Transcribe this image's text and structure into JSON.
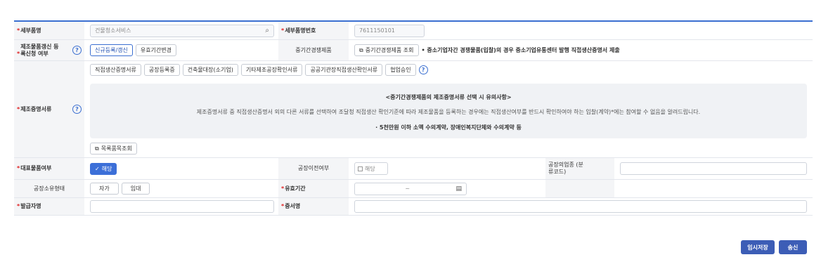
{
  "sub_item": {
    "label": "세부품명",
    "value": "건물청소서비스",
    "code_label": "세부품명번호",
    "code_value": "7611150101"
  },
  "renewal": {
    "label": "제조물품갱신 등록신청 여부",
    "btn_new": "신규등록/갱신",
    "btn_change": "유효기간변경",
    "mid_label": "중기간경쟁제품",
    "mid_btn": "중기간경쟁제품 조회",
    "mid_note": "• 중소기업자간 경쟁물품(입찰)의 경우 중소기업유통센터 발행 직접생산증명서 제출"
  },
  "proof": {
    "label": "제조증명서류",
    "doc_buttons": [
      "직접생산증명서류",
      "공장등록증",
      "건축물대장(소기업)",
      "기타제조공장확인서류",
      "공공기관장직접생산확인서류",
      "협업승인"
    ],
    "notice_title": "<중기간경쟁제품의 제조증명서류 선택 시 유의사항>",
    "notice_body": "제조증명서류 중 직접생산증명서 외의 다른 서류를 선택하여 조달청 직접생산 확인기준에 따라 제조물품을 등록하는 경우에는 직접생산여부를 반드시 확인하여야 하는 입찰(계약)*에는 참여할 수 없음을 알려드립니다.",
    "notice_line": "· 5천만원 이하 소액 수의계약, 장애인복지단체와 수의계약 등",
    "catalog_btn": "목록품목조회"
  },
  "representative": {
    "label": "대표물품여부",
    "applies_btn": "해당",
    "transfer_label": "공장이전여부",
    "transfer_check": "해당",
    "industry_label": "공장의업종 (분류코드)",
    "industry_value": ""
  },
  "ownership": {
    "label": "공장소유형태",
    "own_btn": "자가",
    "lease_btn": "임대",
    "validity_label": "유효기간",
    "date_sep": "~"
  },
  "issuer": {
    "label": "발급자명",
    "value": "",
    "cert_label": "증서명",
    "cert_value": ""
  },
  "actions": {
    "temp_save": "임시저장",
    "send": "송신"
  },
  "colors": {
    "accent": "#3b6fd1",
    "required": "#e02020",
    "primary_button": "#3c5db6"
  }
}
